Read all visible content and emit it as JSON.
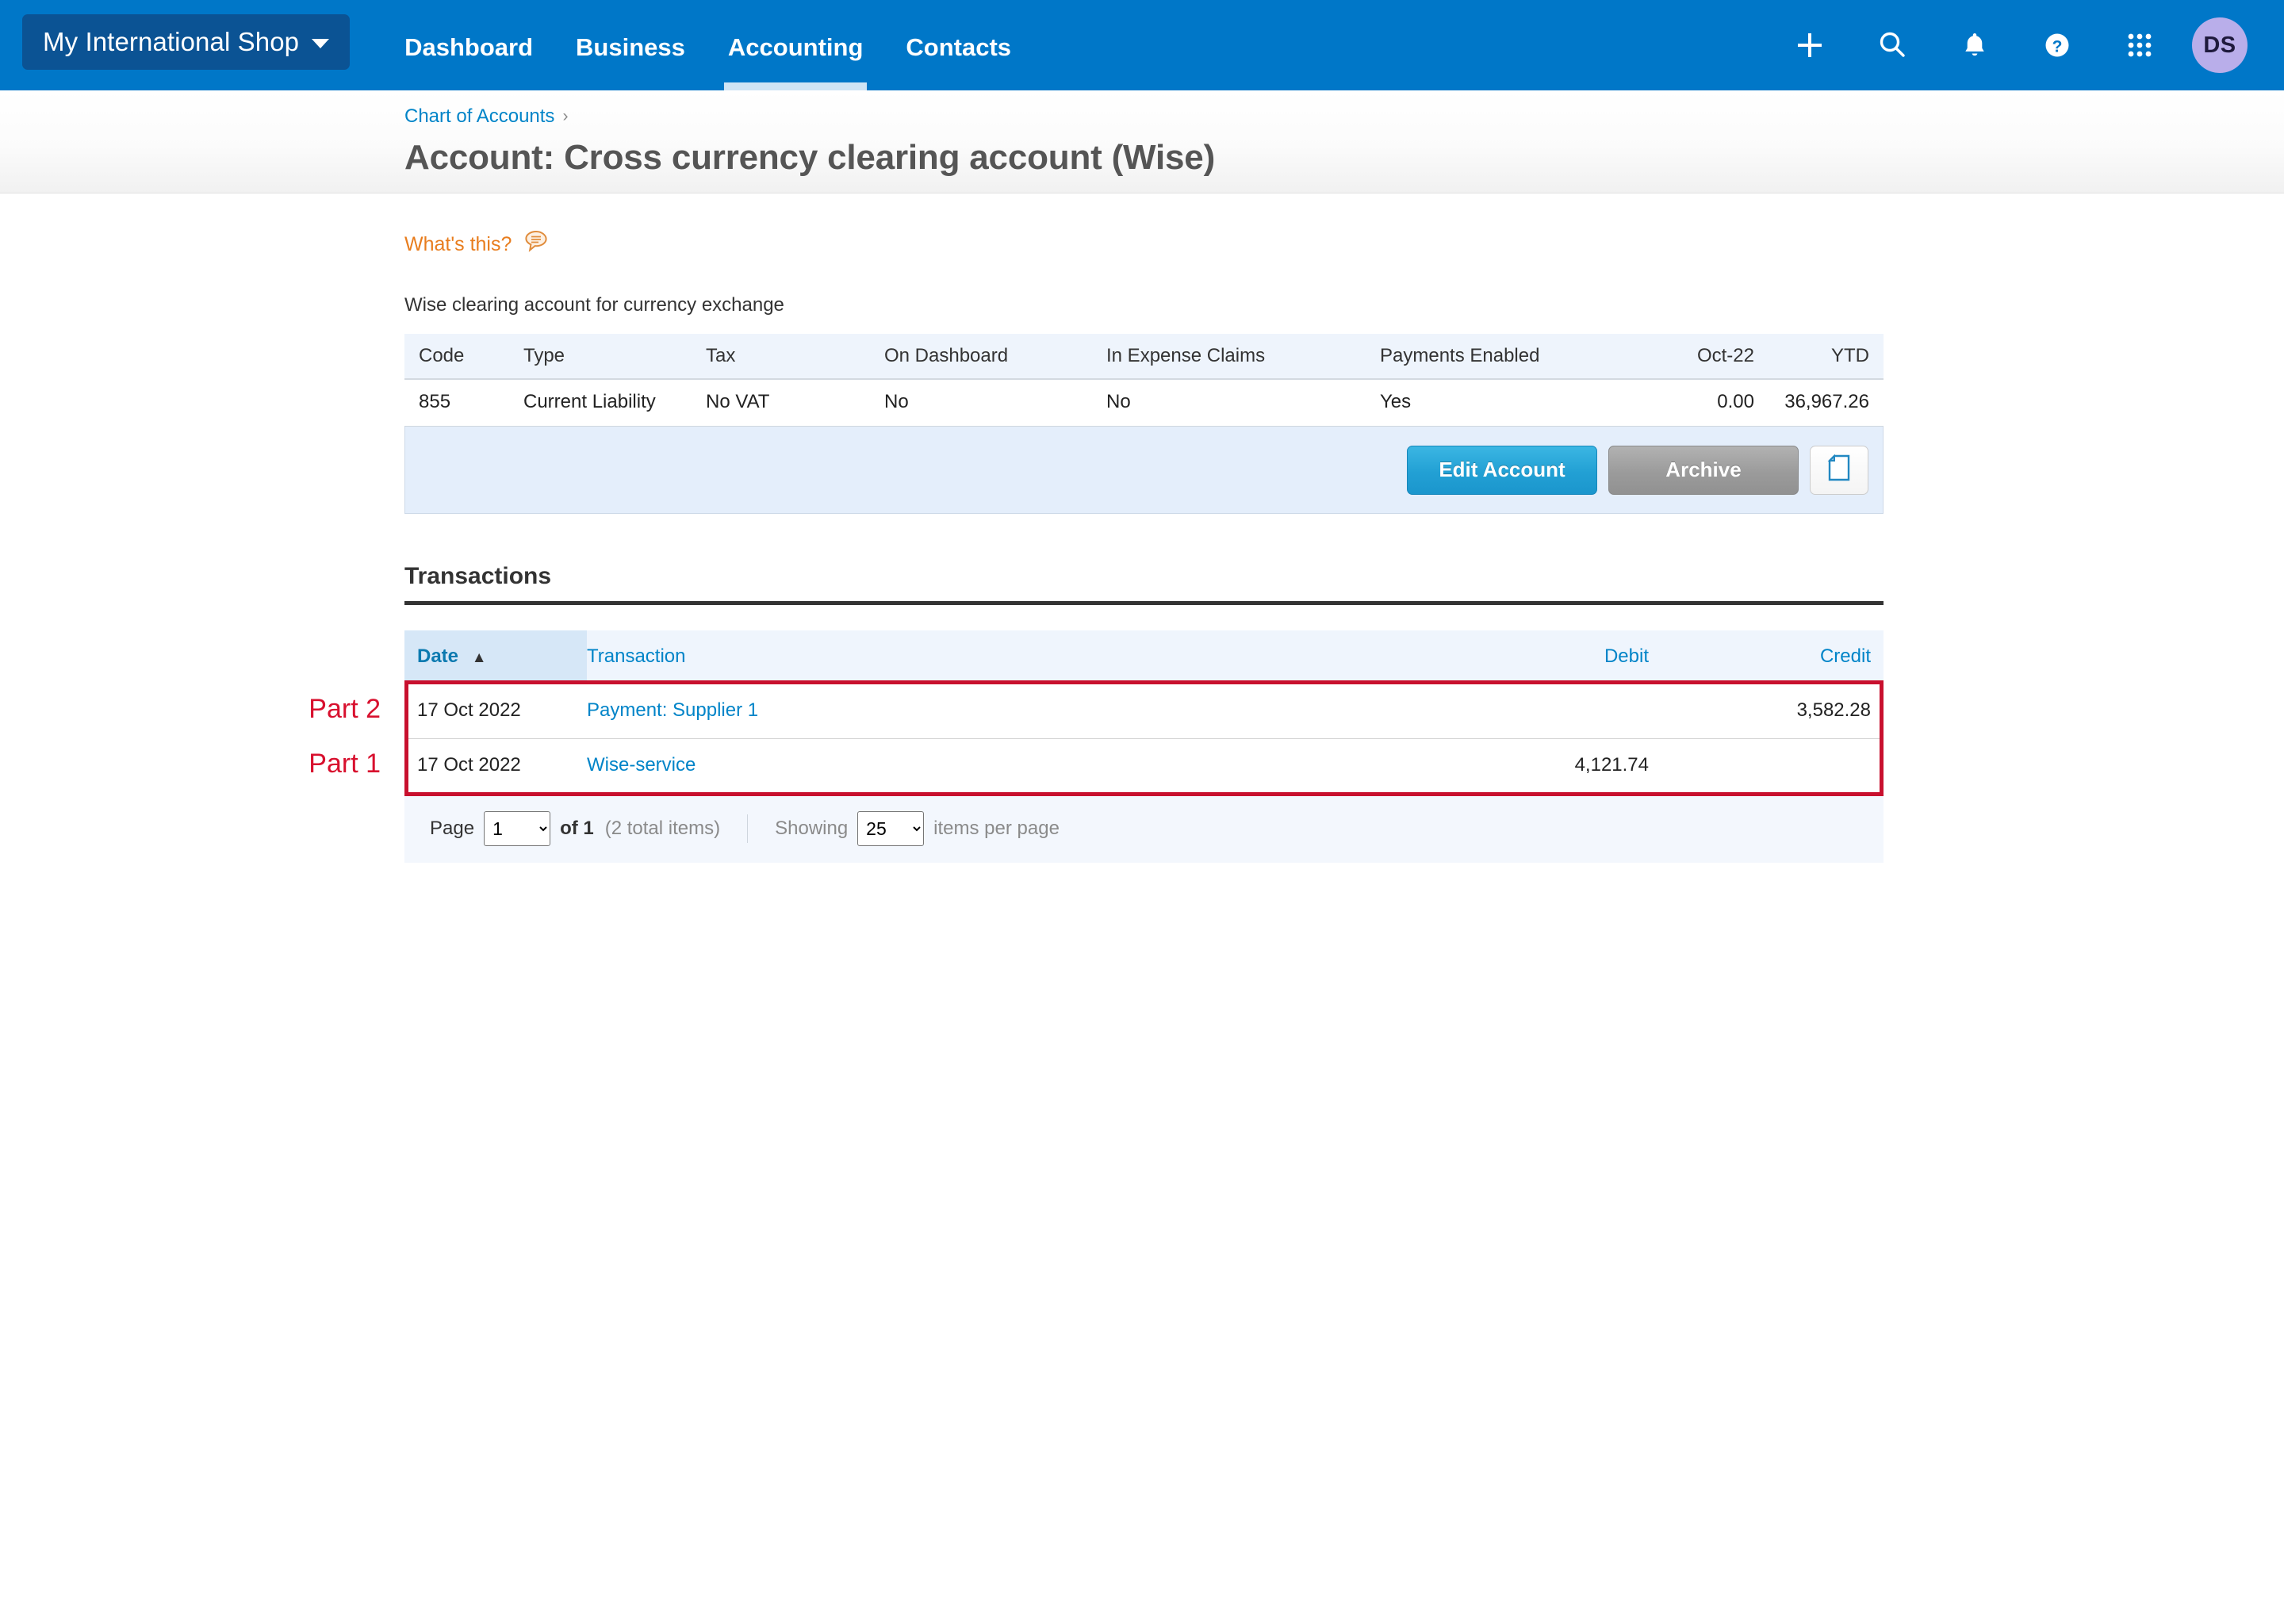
{
  "nav": {
    "org_name": "My International Shop",
    "tabs": [
      {
        "label": "Dashboard",
        "active": false
      },
      {
        "label": "Business",
        "active": false
      },
      {
        "label": "Accounting",
        "active": true
      },
      {
        "label": "Contacts",
        "active": false
      }
    ],
    "icons": [
      "plus-icon",
      "search-icon",
      "bell-icon",
      "help-icon",
      "apps-grid-icon"
    ],
    "avatar_initials": "DS",
    "avatar_color": "#b9aeea",
    "bar_color": "#0077c8",
    "org_button_color": "#0b5394"
  },
  "header": {
    "breadcrumb_label": "Chart of Accounts",
    "breadcrumb_separator": "›",
    "title": "Account: Cross currency clearing account (Wise)"
  },
  "info": {
    "whats_this_label": "What's this?",
    "whats_this_color": "#e87d1e",
    "description": "Wise clearing account for currency exchange",
    "columns": [
      "Code",
      "Type",
      "Tax",
      "On Dashboard",
      "In Expense Claims",
      "Payments Enabled",
      "Oct-22",
      "YTD"
    ],
    "row": [
      "855",
      "Current Liability",
      "No VAT",
      "No",
      "No",
      "Yes",
      "0.00",
      "36,967.26"
    ]
  },
  "actions": {
    "edit_label": "Edit Account",
    "archive_label": "Archive",
    "doc_icon": "document-icon",
    "primary_color": "#22a0d4"
  },
  "transactions": {
    "section_title": "Transactions",
    "columns": {
      "date": "Date",
      "transaction": "Transaction",
      "debit": "Debit",
      "credit": "Credit"
    },
    "sort_indicator": "▲",
    "rows": [
      {
        "date": "17 Oct 2022",
        "transaction": "Payment: Supplier 1",
        "debit": "",
        "credit": "3,582.28"
      },
      {
        "date": "17 Oct 2022",
        "transaction": "Wise-service",
        "debit": "4,121.74",
        "credit": ""
      }
    ],
    "annotations": [
      {
        "label": "Part 2"
      },
      {
        "label": "Part 1"
      }
    ],
    "highlight_color": "#c8102e"
  },
  "pager": {
    "page_label": "Page",
    "page_value": "1",
    "of_label": "of 1",
    "total_items": "(2 total items)",
    "showing_label": "Showing",
    "page_size": "25",
    "per_page_label": "items per page"
  }
}
